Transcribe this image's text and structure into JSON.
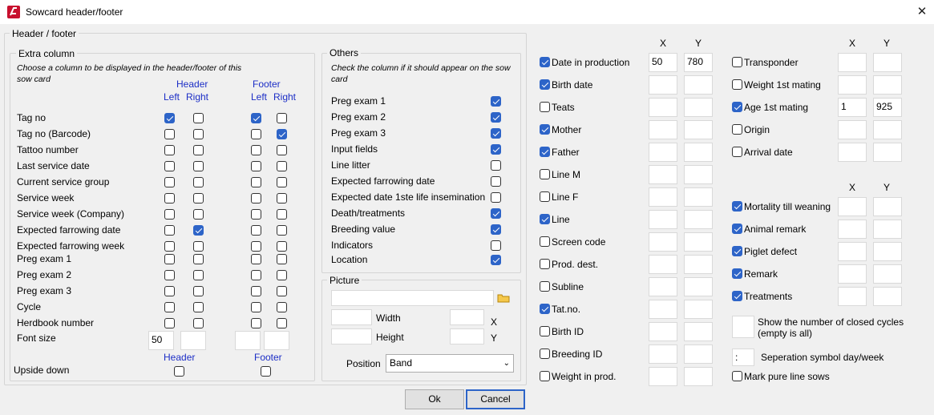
{
  "window": {
    "title": "Sowcard header/footer"
  },
  "hf": {
    "title": "Header / footer",
    "extra": {
      "title": "Extra column",
      "hint": "Choose a column to be displayed in the header/footer of this sow card",
      "header": "Header",
      "footer": "Footer",
      "left": "Left",
      "right": "Right",
      "rows": [
        {
          "label": "Tag no",
          "hl": true,
          "hr": false,
          "fl": true,
          "fr": false
        },
        {
          "label": "Tag no (Barcode)",
          "hl": false,
          "hr": false,
          "fl": false,
          "fr": true
        },
        {
          "label": "Tattoo number",
          "hl": false,
          "hr": false,
          "fl": false,
          "fr": false
        },
        {
          "label": "Last service date",
          "hl": false,
          "hr": false,
          "fl": false,
          "fr": false
        },
        {
          "label": "Current service group",
          "hl": false,
          "hr": false,
          "fl": false,
          "fr": false
        },
        {
          "label": "Service week",
          "hl": false,
          "hr": false,
          "fl": false,
          "fr": false
        },
        {
          "label": "Service week (Company)",
          "hl": false,
          "hr": false,
          "fl": false,
          "fr": false
        },
        {
          "label": "Expected farrowing date",
          "hl": false,
          "hr": true,
          "fl": false,
          "fr": false
        },
        {
          "label": "Expected farrowing week",
          "hl": false,
          "hr": false,
          "fl": false,
          "fr": false
        },
        {
          "label": "Preg exam 1",
          "hl": false,
          "hr": false,
          "fl": false,
          "fr": false
        },
        {
          "label": "Preg exam 2",
          "hl": false,
          "hr": false,
          "fl": false,
          "fr": false
        },
        {
          "label": "Preg exam 3",
          "hl": false,
          "hr": false,
          "fl": false,
          "fr": false
        },
        {
          "label": "Cycle",
          "hl": false,
          "hr": false,
          "fl": false,
          "fr": false
        },
        {
          "label": "Herdbook number",
          "hl": false,
          "hr": false,
          "fl": false,
          "fr": false
        }
      ],
      "font_size_label": "Font size",
      "font_size_values": [
        "50",
        "",
        "",
        ""
      ],
      "header_caption": "Header",
      "footer_caption": "Footer",
      "upside_down_label": "Upside down",
      "upside_header": false,
      "upside_footer": false
    },
    "others": {
      "title": "Others",
      "hint": "Check the column if it should appear on the sow card",
      "rows": [
        {
          "label": "Preg exam 1",
          "checked": true
        },
        {
          "label": "Preg exam 2",
          "checked": true
        },
        {
          "label": "Preg exam 3",
          "checked": true
        },
        {
          "label": "Input fields",
          "checked": true
        },
        {
          "label": "Line litter",
          "checked": false
        },
        {
          "label": "Expected farrowing date",
          "checked": false
        },
        {
          "label": "Expected date 1ste life insemination",
          "checked": false
        },
        {
          "label": "Death/treatments",
          "checked": true
        },
        {
          "label": "Breeding value",
          "checked": true
        },
        {
          "label": "Indicators",
          "checked": false
        },
        {
          "label": "Location",
          "checked": true
        }
      ]
    },
    "picture": {
      "title": "Picture",
      "path": "",
      "width_label": "Width",
      "height_label": "Height",
      "x_label": "X",
      "y_label": "Y",
      "position_label": "Position",
      "position_value": "Band",
      "folder_icon": "folder-icon"
    }
  },
  "mid": {
    "x_label": "X",
    "y_label": "Y",
    "rows": [
      {
        "label": "Date in production",
        "checked": true,
        "x": "50",
        "y": "780"
      },
      {
        "label": "Birth date",
        "checked": true,
        "x": "",
        "y": ""
      },
      {
        "label": "Teats",
        "checked": false,
        "x": "",
        "y": ""
      },
      {
        "label": "Mother",
        "checked": true,
        "x": "",
        "y": ""
      },
      {
        "label": "Father",
        "checked": true,
        "x": "",
        "y": ""
      },
      {
        "label": "Line M",
        "checked": false,
        "x": "",
        "y": ""
      },
      {
        "label": "Line F",
        "checked": false,
        "x": "",
        "y": ""
      },
      {
        "label": "Line",
        "checked": true,
        "x": "",
        "y": ""
      },
      {
        "label": "Screen code",
        "checked": false,
        "x": "",
        "y": ""
      },
      {
        "label": "Prod. dest.",
        "checked": false,
        "x": "",
        "y": ""
      },
      {
        "label": "Subline",
        "checked": false,
        "x": "",
        "y": ""
      },
      {
        "label": "Tat.no.",
        "checked": true,
        "x": "",
        "y": ""
      },
      {
        "label": "Birth ID",
        "checked": false,
        "x": "",
        "y": ""
      },
      {
        "label": "Breeding ID",
        "checked": false,
        "x": "",
        "y": ""
      },
      {
        "label": "Weight in prod.",
        "checked": false,
        "x": "",
        "y": ""
      }
    ]
  },
  "right": {
    "x_label": "X",
    "y_label": "Y",
    "rows1": [
      {
        "label": "Transponder",
        "checked": false,
        "x": "",
        "y": ""
      },
      {
        "label": "Weight 1st mating",
        "checked": false,
        "x": "",
        "y": ""
      },
      {
        "label": "Age 1st mating",
        "checked": true,
        "x": "1",
        "y": "925"
      },
      {
        "label": "Origin",
        "checked": false,
        "x": "",
        "y": ""
      },
      {
        "label": "Arrival date",
        "checked": false,
        "x": "",
        "y": ""
      }
    ],
    "x2_label": "X",
    "y2_label": "Y",
    "rows2": [
      {
        "label": "Mortality till weaning",
        "checked": true,
        "x": "",
        "y": ""
      },
      {
        "label": "Animal remark",
        "checked": true,
        "x": "",
        "y": ""
      },
      {
        "label": "Piglet defect",
        "checked": true,
        "x": "",
        "y": ""
      },
      {
        "label": "Remark",
        "checked": true,
        "x": "",
        "y": ""
      },
      {
        "label": "Treatments",
        "checked": true,
        "x": "",
        "y": ""
      }
    ],
    "closed_cycles_value": "",
    "closed_cycles_label": "Show the number of closed cycles (empty is all)",
    "sep_value": ":",
    "sep_label": "Seperation symbol day/week",
    "mark_pure_label": "Mark pure line sows",
    "mark_pure_checked": false
  },
  "buttons": {
    "ok": "Ok",
    "cancel": "Cancel"
  }
}
